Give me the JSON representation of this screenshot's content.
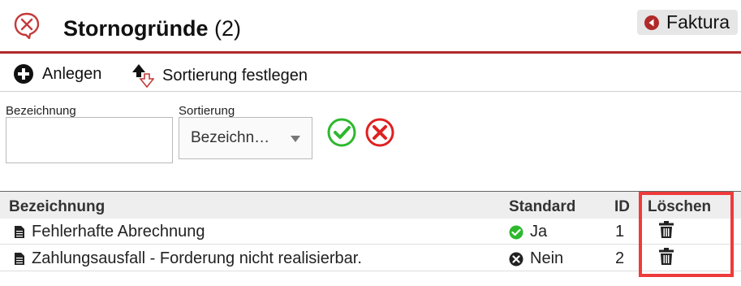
{
  "header": {
    "title": "Stornogründe",
    "count": "(2)",
    "faktura_label": "Faktura"
  },
  "toolbar": {
    "create_label": "Anlegen",
    "sort_label": "Sortierung festlegen"
  },
  "filter": {
    "name_label": "Bezeichnung",
    "name_value": "",
    "sort_label": "Sortierung",
    "sort_selected": "Bezeichn…"
  },
  "table": {
    "columns": [
      "Bezeichnung",
      "Standard",
      "ID",
      "Löschen"
    ],
    "rows": [
      {
        "name": "Fehlerhafte Abrechnung",
        "standard": "Ja",
        "standard_icon": "check-circle-icon",
        "id": "1"
      },
      {
        "name": "Zahlungsausfall - Forderung nicht realisierbar.",
        "standard": "Nein",
        "standard_icon": "x-circle-icon",
        "id": "2"
      }
    ]
  },
  "colors": {
    "accent_red": "#b02a2a",
    "check_green": "#2eb82e",
    "cancel_red": "#e02020",
    "highlight_red": "#ee3b3b"
  }
}
